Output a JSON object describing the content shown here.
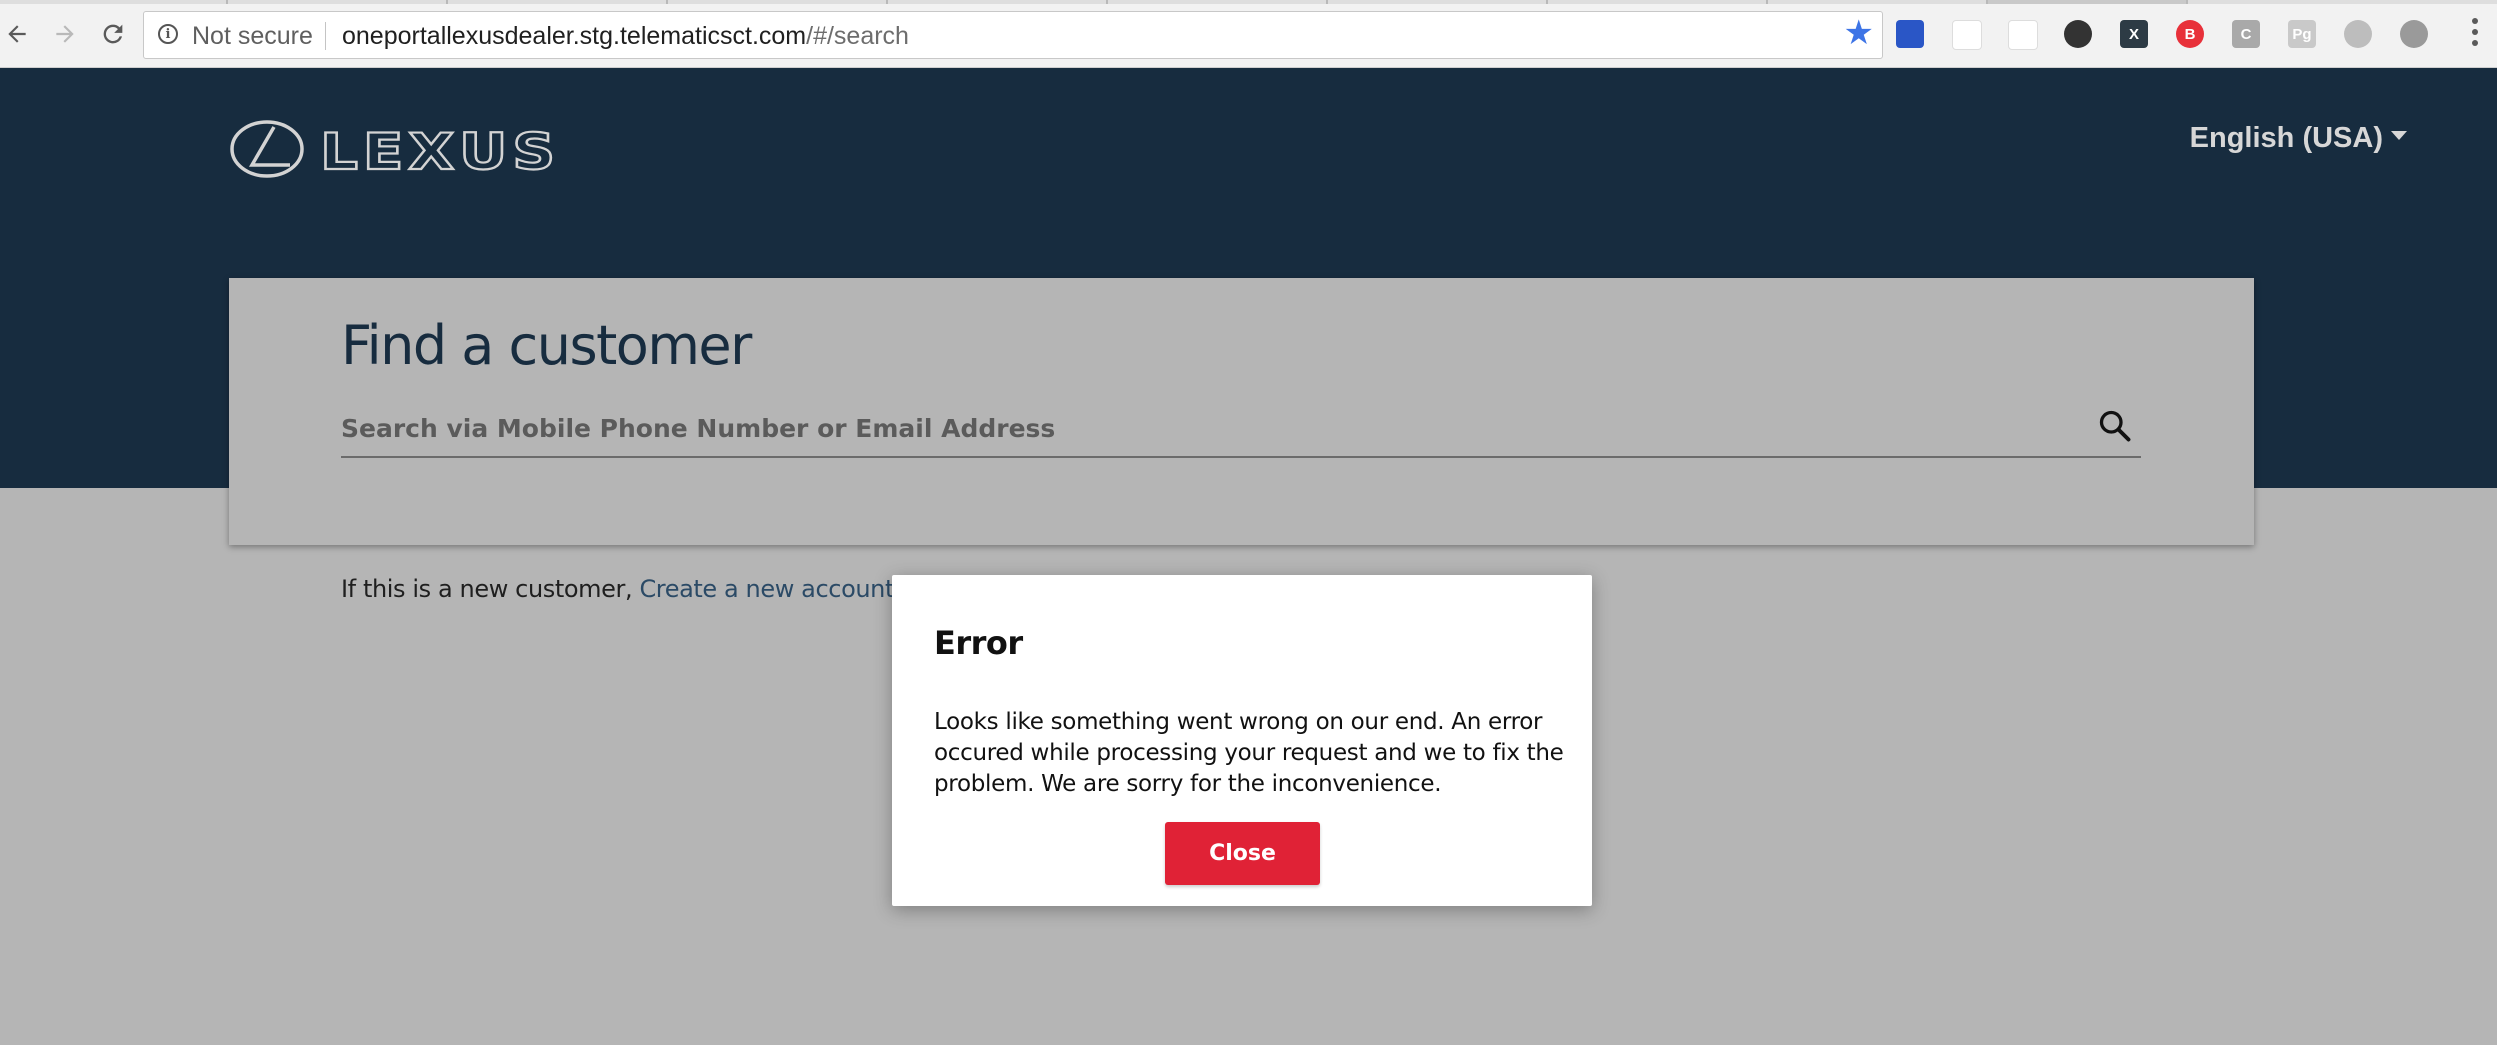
{
  "browser": {
    "security_label": "Not secure",
    "url_host": "oneportallexusdealer.stg.telematicsct.com",
    "url_path": "/#/search",
    "extensions": [
      {
        "name": "extension-1",
        "glyph": "",
        "color": "#2a56c6"
      },
      {
        "name": "extension-2",
        "glyph": "",
        "color": "#ffffff"
      },
      {
        "name": "extension-3",
        "glyph": "",
        "color": "#ffffff"
      },
      {
        "name": "extension-4",
        "glyph": "",
        "color": "#333333"
      },
      {
        "name": "extension-x",
        "glyph": "X",
        "color": "#2d3b45"
      },
      {
        "name": "extension-b",
        "glyph": "B",
        "color": "#e8313a"
      },
      {
        "name": "extension-c",
        "glyph": "C",
        "color": "#a9a9a9"
      },
      {
        "name": "extension-pg",
        "glyph": "Pg",
        "color": "#c9c9c9"
      },
      {
        "name": "extension-circle-1",
        "glyph": "",
        "color": "#bdbdbd"
      },
      {
        "name": "extension-circle-2",
        "glyph": "",
        "color": "#9a9a9a"
      }
    ]
  },
  "header": {
    "brand": "LEXUS",
    "language": "English (USA)"
  },
  "search_card": {
    "title": "Find a customer",
    "placeholder": "Search via Mobile Phone Number or Email Address"
  },
  "new_customer": {
    "prefix": "If this is a new customer, ",
    "link": "Create a new account"
  },
  "modal": {
    "title": "Error",
    "message": "Looks like something went wrong on our end. An error occured while processing your request and we to fix the problem. We are sorry for the inconvenience.",
    "close_label": "Close"
  }
}
